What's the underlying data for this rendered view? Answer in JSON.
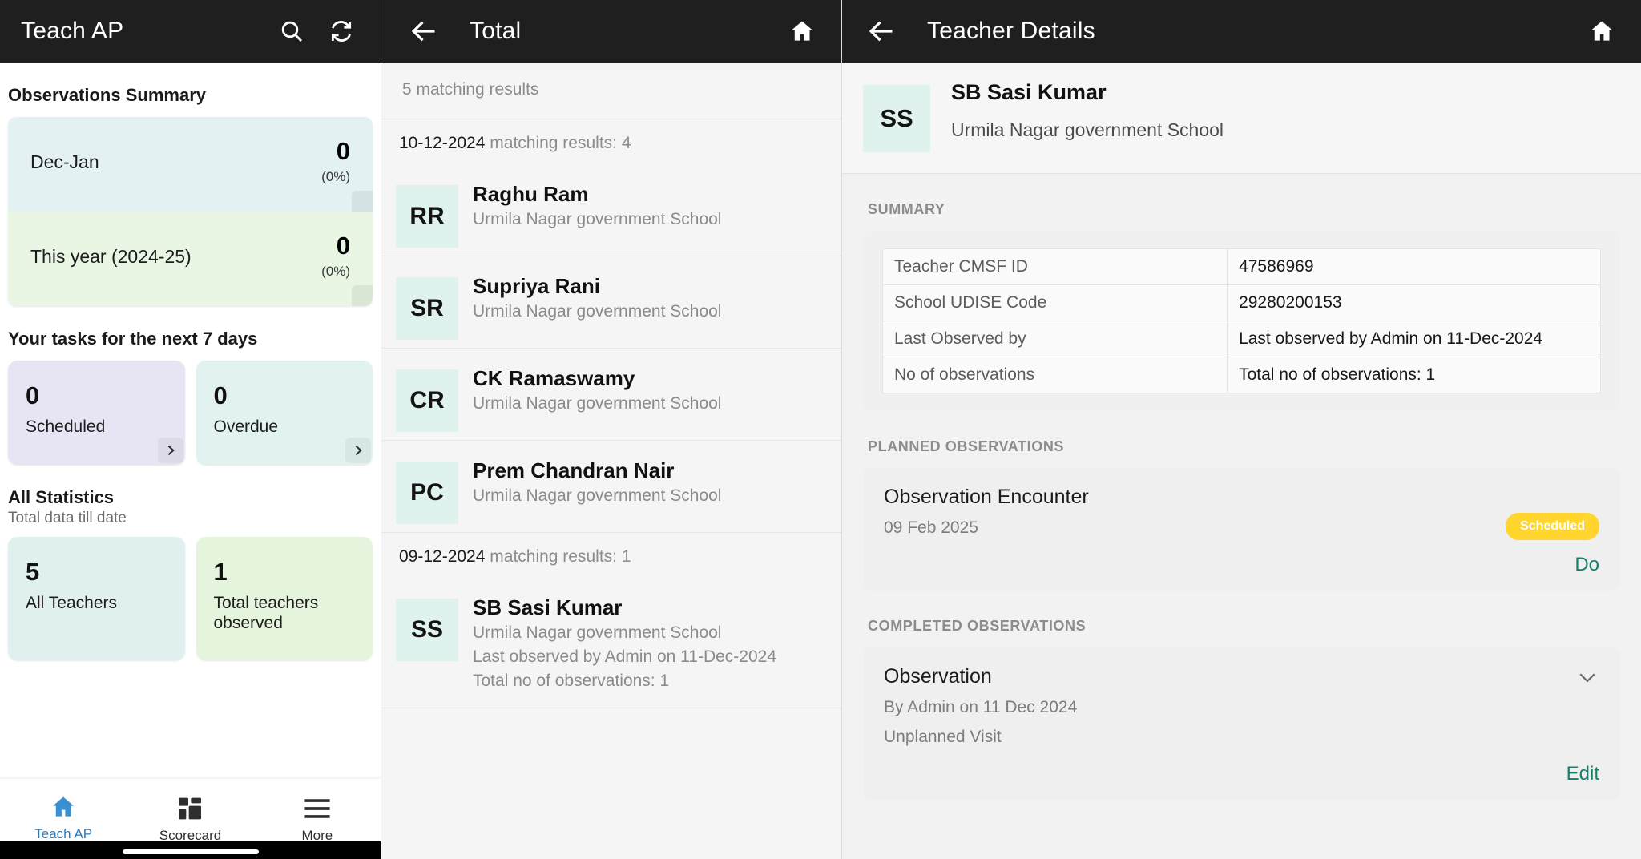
{
  "panel1": {
    "appbar": {
      "title": "Teach AP",
      "search_icon": "search-icon",
      "sync_icon": "sync-icon"
    },
    "observations_summary": {
      "heading": "Observations Summary",
      "rows": [
        {
          "label": "Dec-Jan",
          "value": "0",
          "percent": "(0%)"
        },
        {
          "label": "This year (2024-25)",
          "value": "0",
          "percent": "(0%)"
        }
      ]
    },
    "tasks": {
      "heading": "Your tasks for the next 7 days",
      "tiles": [
        {
          "value": "0",
          "label": "Scheduled"
        },
        {
          "value": "0",
          "label": "Overdue"
        }
      ]
    },
    "all_statistics": {
      "heading": "All Statistics",
      "subheading": "Total data till date",
      "tiles": [
        {
          "value": "5",
          "label": "All Teachers"
        },
        {
          "value": "1",
          "label": "Total teachers observed"
        }
      ]
    },
    "bottom_nav": [
      {
        "label": "Teach AP",
        "icon": "home-icon",
        "active": true
      },
      {
        "label": "Scorecard",
        "icon": "scorecard-icon",
        "active": false
      },
      {
        "label": "More",
        "icon": "menu-icon",
        "active": false
      }
    ]
  },
  "panel2": {
    "appbar": {
      "title": "Total",
      "back_icon": "back-arrow-icon",
      "home_icon": "home-icon"
    },
    "matching_results": "5 matching results",
    "groups": [
      {
        "date": "10-12-2024",
        "count_text": "matching results: 4",
        "rows": [
          {
            "initials": "RR",
            "name": "Raghu Ram",
            "school": "Urmila Nagar government School",
            "extra": []
          },
          {
            "initials": "SR",
            "name": "Supriya Rani",
            "school": "Urmila Nagar government School",
            "extra": []
          },
          {
            "initials": "CR",
            "name": "CK Ramaswamy",
            "school": "Urmila Nagar government School",
            "extra": []
          },
          {
            "initials": "PC",
            "name": "Prem Chandran Nair",
            "school": "Urmila Nagar government School",
            "extra": []
          }
        ]
      },
      {
        "date": "09-12-2024",
        "count_text": "matching results: 1",
        "rows": [
          {
            "initials": "SS",
            "name": "SB Sasi Kumar",
            "school": "Urmila Nagar government School",
            "extra": [
              "Last observed by Admin on 11-Dec-2024",
              "Total no of observations: 1"
            ]
          }
        ]
      }
    ]
  },
  "panel3": {
    "appbar": {
      "title": "Teacher Details",
      "back_icon": "back-arrow-icon",
      "home_icon": "home-icon"
    },
    "teacher": {
      "initials": "SS",
      "name": "SB Sasi Kumar",
      "school": "Urmila Nagar government School"
    },
    "summary": {
      "label": "SUMMARY",
      "rows": [
        {
          "key": "Teacher CMSF ID",
          "value": "47586969"
        },
        {
          "key": "School UDISE Code",
          "value": "29280200153"
        },
        {
          "key": "Last Observed by",
          "value": "Last observed by Admin on 11-Dec-2024"
        },
        {
          "key": "No of observations",
          "value": "Total no of observations: 1"
        }
      ]
    },
    "planned_observations": {
      "label": "PLANNED OBSERVATIONS",
      "items": [
        {
          "title": "Observation Encounter",
          "date": "09 Feb 2025",
          "badge": "Scheduled",
          "action": "Do"
        }
      ]
    },
    "completed_observations": {
      "label": "COMPLETED OBSERVATIONS",
      "items": [
        {
          "title": "Observation",
          "by": "By Admin on 11 Dec 2024",
          "visit": "Unplanned Visit",
          "action": "Edit",
          "expand_icon": "chevron-down-icon"
        }
      ]
    }
  },
  "colors": {
    "appbar_bg": "#1f1f1f",
    "accent_teal": "#17806b",
    "badge_yellow": "#ffd52e",
    "nav_active": "#2b7bbd",
    "card_blue": "#e3f1f2",
    "card_green": "#e9f6e3",
    "card_purple": "#e7e4f3",
    "avatar_bg": "#e0f2ee"
  }
}
